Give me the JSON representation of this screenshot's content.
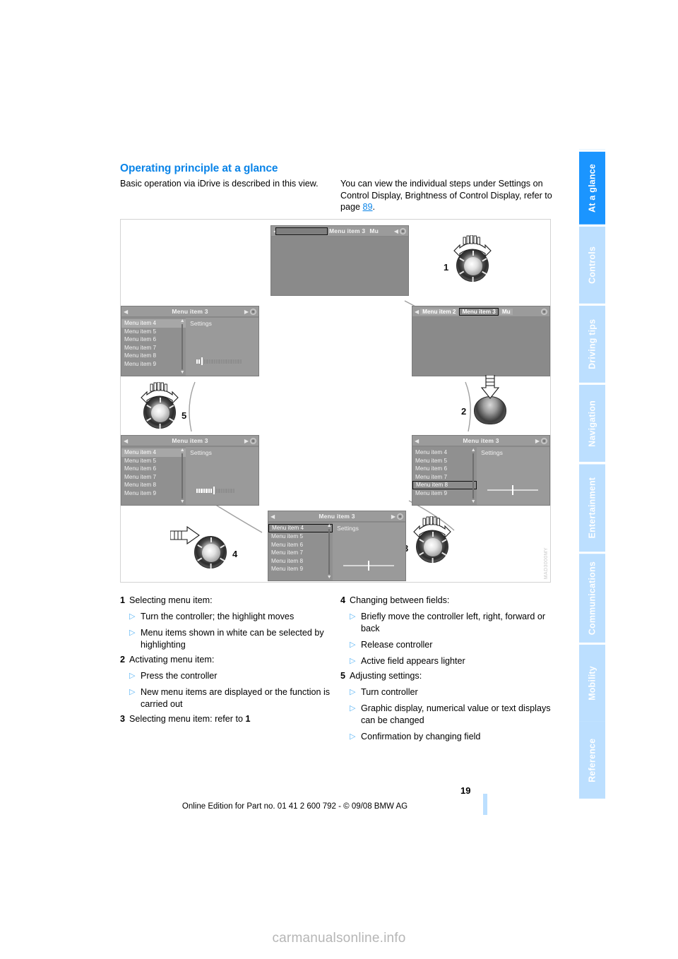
{
  "document": {
    "title": "Operating principle at a glance",
    "page_number": "19",
    "footer": "Online Edition for Part no. 01 41 2 600 792 - © 09/08 BMW AG",
    "watermark": "carmanualsonline.info",
    "figure_code": "MAD3000MY"
  },
  "intro": {
    "left": "Basic operation via iDrive is described in this view.",
    "right_before": "You can view the individual steps under Settings on Control Display, Brightness of Control Display, refer to page ",
    "right_link": "89",
    "right_after": "."
  },
  "sidebar": {
    "tabs": [
      {
        "label": "At a glance",
        "active": true
      },
      {
        "label": "Controls",
        "active": false
      },
      {
        "label": "Driving tips",
        "active": false
      },
      {
        "label": "Navigation",
        "active": false
      },
      {
        "label": "Entertainment",
        "active": false
      },
      {
        "label": "Communications",
        "active": false
      },
      {
        "label": "Mobility",
        "active": false
      },
      {
        "label": "Reference",
        "active": false
      }
    ]
  },
  "figure": {
    "screens": {
      "top": {
        "title": "Menu item 3",
        "right_partial": "Mu",
        "type": "tab-bar-blank"
      },
      "right_upper": {
        "tabs": [
          "Menu item 2",
          "Menu item 3",
          "Mu"
        ],
        "active_tab": "Menu item 3",
        "type": "tab-bar-blank"
      },
      "right_lower": {
        "title": "Menu item 3",
        "settings_label": "Settings",
        "items": [
          "Menu item 4",
          "Menu item 5",
          "Menu item 6",
          "Menu item 7",
          "Menu item 8",
          "Menu item 9"
        ],
        "highlighted": "Menu item 8",
        "highlight_style": "dark-outline",
        "control": "slider"
      },
      "bottom_center": {
        "title": "Menu item 3",
        "settings_label": "Settings",
        "items": [
          "Menu item 4",
          "Menu item 5",
          "Menu item 6",
          "Menu item 7",
          "Menu item 8",
          "Menu item 9"
        ],
        "highlighted": "Menu item 4",
        "highlight_style": "dark-outline",
        "control": "slider"
      },
      "left_lower": {
        "title": "Menu item 3",
        "settings_label": "Settings",
        "items": [
          "Menu item 4",
          "Menu item 5",
          "Menu item 6",
          "Menu item 7",
          "Menu item 8",
          "Menu item 9"
        ],
        "highlighted": "Menu item 4",
        "highlight_style": "light-fill",
        "control": "bar-gauge",
        "gauge_filled": 7
      },
      "left_upper": {
        "title": "Menu item 3",
        "settings_label": "Settings",
        "items": [
          "Menu item 4",
          "Menu item 5",
          "Menu item 6",
          "Menu item 7",
          "Menu item 8",
          "Menu item 9"
        ],
        "highlighted": "Menu item 4",
        "highlight_style": "light-fill",
        "control": "bar-gauge",
        "gauge_filled": 2
      }
    },
    "controllers": [
      {
        "number": "1",
        "action": "turn"
      },
      {
        "number": "2",
        "action": "press"
      },
      {
        "number": "3",
        "action": "turn"
      },
      {
        "number": "4",
        "action": "move-sideways"
      },
      {
        "number": "5",
        "action": "turn"
      }
    ]
  },
  "steps_left": [
    {
      "num": "1",
      "text": "Selecting menu item:",
      "subs": [
        "Turn the controller; the highlight moves",
        "Menu items shown in white can be selected by highlighting"
      ]
    },
    {
      "num": "2",
      "text": "Activating menu item:",
      "subs": [
        "Press the controller",
        "New menu items are displayed or the function is carried out"
      ]
    },
    {
      "num": "3",
      "text": "Selecting menu item: refer to 1",
      "subs": []
    }
  ],
  "steps_right": [
    {
      "num": "4",
      "text": "Changing between fields:",
      "subs": [
        "Briefly move the controller left, right, forward or back",
        "Release controller",
        "Active field appears lighter"
      ]
    },
    {
      "num": "5",
      "text": "Adjusting settings:",
      "subs": [
        "Turn controller",
        "Graphic display, numerical value or text displays can be changed",
        "Confirmation by changing field"
      ]
    }
  ],
  "colors": {
    "accent_blue": "#0a84e8",
    "tab_active": "#1b95ff",
    "tab_inactive": "#bcdfff",
    "bullet_blue": "#59b4f5"
  }
}
